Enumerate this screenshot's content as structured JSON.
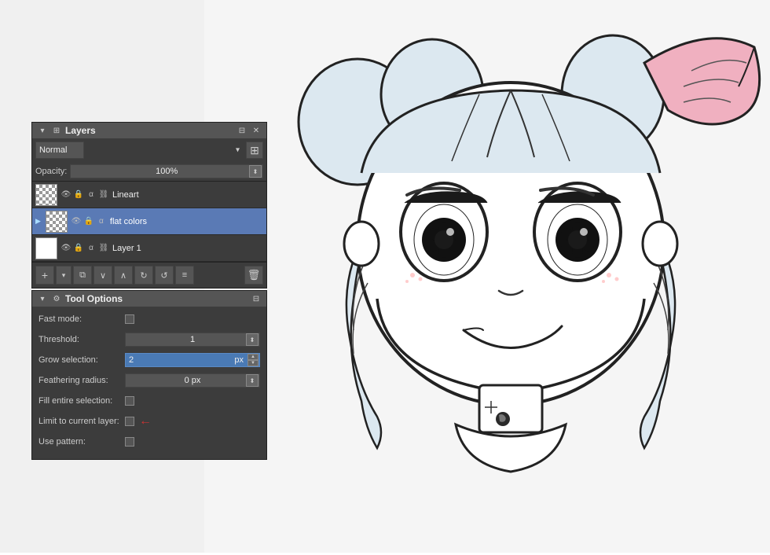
{
  "canvas": {
    "bg_color": "#f5f5f5"
  },
  "layers_panel": {
    "title": "Layers",
    "blend_mode": "Normal",
    "opacity_label": "Opacity:",
    "opacity_value": "100%",
    "layers": [
      {
        "name": "Lineart",
        "selected": false,
        "has_thumb": false
      },
      {
        "name": "flat colors",
        "selected": true,
        "has_thumb": false
      },
      {
        "name": "Layer 1",
        "selected": false,
        "has_thumb": true
      }
    ],
    "toolbar_buttons": [
      "+",
      "▾",
      "⧉",
      "∨",
      "∧",
      "↺",
      "↻",
      "≡"
    ]
  },
  "tool_options_panel": {
    "title": "Tool Options",
    "options": [
      {
        "label": "Fast mode:",
        "type": "checkbox",
        "value": false
      },
      {
        "label": "Threshold:",
        "type": "slider",
        "value": "1"
      },
      {
        "label": "Grow selection:",
        "type": "slider-blue",
        "value": "2",
        "unit": "px"
      },
      {
        "label": "Feathering radius:",
        "type": "slider",
        "value": "0",
        "unit": "px"
      },
      {
        "label": "Fill entire selection:",
        "type": "checkbox",
        "value": false
      },
      {
        "label": "Limit to current layer:",
        "type": "checkbox-arrow",
        "value": false
      },
      {
        "label": "Use pattern:",
        "type": "checkbox",
        "value": false
      }
    ]
  }
}
